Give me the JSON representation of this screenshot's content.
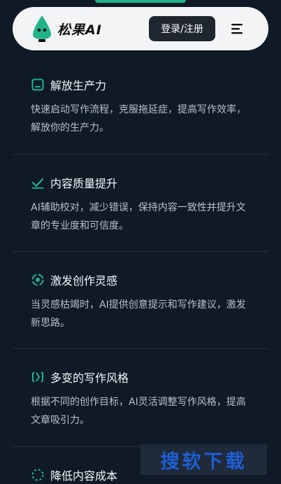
{
  "header": {
    "brand": "松果AI",
    "login_label": "登录/注册",
    "logo_icon": "pine-cone-logo-icon",
    "menu_icon": "menu-icon",
    "accent_color": "#22b38a"
  },
  "features": [
    {
      "icon": "clipboard-icon",
      "title": "解放生产力",
      "desc": "快速启动写作流程，克服拖延症，提高写作效率，解放你的生产力。"
    },
    {
      "icon": "check-icon",
      "title": "内容质量提升",
      "desc": "AI辅助校对，减少错误，保持内容一致性并提升文章的专业度和可信度。"
    },
    {
      "icon": "target-icon",
      "title": "激发创作灵感",
      "desc": "当灵感枯竭时，AI提供创意提示和写作建议，激发新思路。"
    },
    {
      "icon": "brackets-icon",
      "title": "多变的写作风格",
      "desc": "根据不同的创作目标，AI灵活调整写作风格，提高文章吸引力。"
    },
    {
      "icon": "dashed-circle-icon",
      "title": "降低内容成本",
      "desc": ""
    }
  ],
  "watermark": "搜软下载"
}
